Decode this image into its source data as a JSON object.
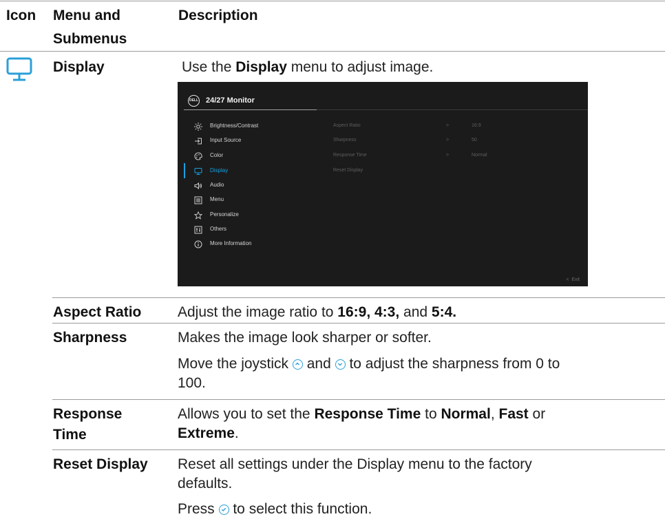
{
  "header": {
    "col_icon": "Icon",
    "col_menu_line1": "Menu and",
    "col_menu_line2": "Submenus",
    "col_description": "Description"
  },
  "display_row": {
    "icon": "monitor-icon",
    "menu_label": "Display",
    "desc_prefix": "Use the ",
    "desc_bold": "Display",
    "desc_suffix": " menu to adjust image."
  },
  "osd": {
    "logo_text": "DELL",
    "title": "24/27 Monitor",
    "menu": [
      {
        "icon": "brightness-icon",
        "label": "Brightness/Contrast"
      },
      {
        "icon": "input-source-icon",
        "label": "Input Source"
      },
      {
        "icon": "color-icon",
        "label": "Color"
      },
      {
        "icon": "display-icon",
        "label": "Display",
        "selected": true
      },
      {
        "icon": "audio-icon",
        "label": "Audio"
      },
      {
        "icon": "menu-icon",
        "label": "Menu"
      },
      {
        "icon": "star-icon",
        "label": "Personalize"
      },
      {
        "icon": "others-icon",
        "label": "Others"
      },
      {
        "icon": "info-icon",
        "label": "More Information"
      }
    ],
    "submenu": [
      {
        "label": "Aspect Ratio",
        "arrow": ">",
        "value": "16:9"
      },
      {
        "label": "Sharpness",
        "arrow": ">",
        "value": "50"
      },
      {
        "label": "Response Time",
        "arrow": ">",
        "value": "Normal"
      },
      {
        "label": "Reset Display",
        "arrow": "",
        "value": ""
      }
    ],
    "exit_arrow": "<",
    "exit_label": "Exit"
  },
  "rows": {
    "aspect": {
      "label": "Aspect Ratio",
      "t1": "Adjust the image ratio to ",
      "b1": "16:9, 4:3,",
      "t2": " and ",
      "b2": "5:4."
    },
    "sharpness": {
      "label": "Sharpness",
      "line1": "Makes the image look sharper or softer.",
      "p2_a": "Move the joystick ",
      "p2_b": " and ",
      "p2_c": " to adjust the sharpness from 0 to",
      "p2_d": "100."
    },
    "response": {
      "label_line1": "Response",
      "label_line2": "Time",
      "t1": "Allows you to set the ",
      "b1": "Response Time",
      "t2": " to ",
      "b2": "Normal",
      "t3": ", ",
      "b3": "Fast",
      "t4": " or",
      "b4": "Extreme",
      "t5": "."
    },
    "reset": {
      "label": "Reset Display",
      "line1": "Reset all settings under the Display menu to the factory",
      "line2": "defaults.",
      "p2_a": "Press ",
      "p2_b": " to select this function."
    }
  },
  "colors": {
    "accent": "#2a9fd8",
    "osd_bg": "#1b1b1b",
    "osd_selected": "#1aa1e0"
  }
}
